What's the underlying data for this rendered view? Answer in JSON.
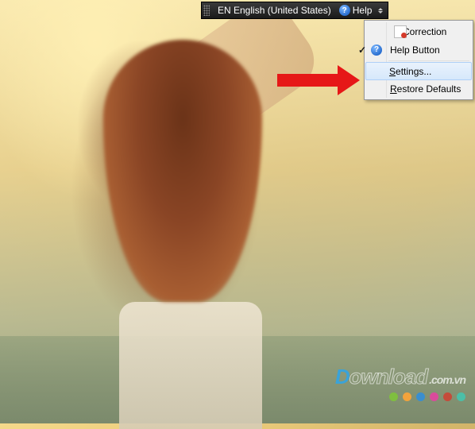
{
  "toolbar": {
    "language_label": "EN English (United States)",
    "help_label": "Help"
  },
  "menu": {
    "items": [
      {
        "label": "Correction",
        "checked": false,
        "icon": "correction-icon",
        "highlighted": false
      },
      {
        "label": "Help Button",
        "checked": true,
        "icon": "help-q-icon",
        "highlighted": false
      },
      {
        "label_pre": "",
        "mnemonic": "S",
        "label_post": "ettings...",
        "highlighted": true
      },
      {
        "label_pre": "",
        "mnemonic": "R",
        "label_post": "estore Defaults",
        "highlighted": false
      }
    ]
  },
  "watermark": {
    "brand_first": "D",
    "brand_rest": "ownload",
    "ext": ".com.vn",
    "dot_colors": [
      "#7fbf3f",
      "#f2a33c",
      "#3a8ecf",
      "#d94b9b",
      "#c44b3a",
      "#4bbfa8"
    ]
  }
}
